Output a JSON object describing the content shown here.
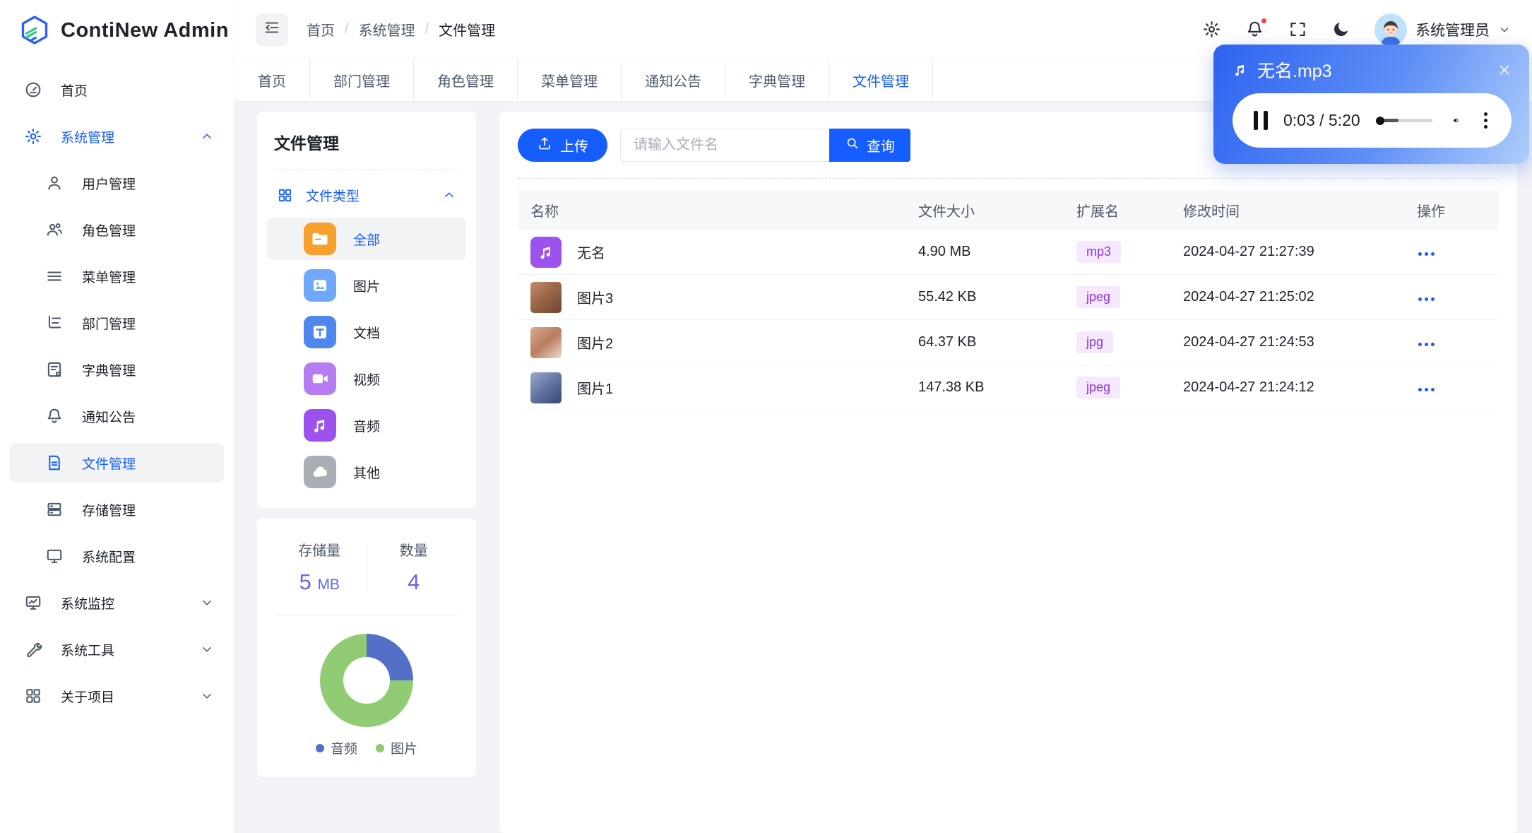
{
  "app": {
    "title": "ContiNew Admin",
    "logo_icon": "logo-hexagon"
  },
  "header": {
    "collapse_icon": "sidebar-collapse",
    "breadcrumb": {
      "items": [
        "首页",
        "系统管理",
        "文件管理"
      ],
      "separator": "/"
    },
    "action_icons": [
      "gear",
      "bell",
      "fullscreen",
      "moon"
    ],
    "bell_has_red_dot": true,
    "user": {
      "name": "系统管理员",
      "dropdown_icon": "chevron-down"
    }
  },
  "sidebar": {
    "items": [
      {
        "label": "首页",
        "icon": "dashboard"
      },
      {
        "label": "系统管理",
        "icon": "gear",
        "expanded": true
      },
      {
        "label": "用户管理",
        "icon": "user"
      },
      {
        "label": "角色管理",
        "icon": "users"
      },
      {
        "label": "菜单管理",
        "icon": "menu"
      },
      {
        "label": "部门管理",
        "icon": "tree"
      },
      {
        "label": "字典管理",
        "icon": "dict"
      },
      {
        "label": "通知公告",
        "icon": "bell"
      },
      {
        "label": "文件管理",
        "icon": "file",
        "active": true
      },
      {
        "label": "存储管理",
        "icon": "storage"
      },
      {
        "label": "系统配置",
        "icon": "config"
      },
      {
        "label": "系统监控",
        "icon": "monitor"
      },
      {
        "label": "系统工具",
        "icon": "wrench"
      },
      {
        "label": "关于项目",
        "icon": "grid"
      }
    ]
  },
  "tabs": [
    "首页",
    "部门管理",
    "角色管理",
    "菜单管理",
    "通知公告",
    "字典管理",
    "文件管理"
  ],
  "active_tab": "文件管理",
  "filepanel": {
    "title": "文件管理",
    "tree_header": {
      "label": "文件类型",
      "icon": "grid",
      "chevron": "chevron-up"
    },
    "types": [
      {
        "label": "全部",
        "icon": "folder",
        "color": "#f7a02d",
        "active": true
      },
      {
        "label": "图片",
        "icon": "image",
        "color": "#6fa8f8"
      },
      {
        "label": "文档",
        "icon": "doc",
        "color": "#4f87ef"
      },
      {
        "label": "视频",
        "icon": "video",
        "color": "#b67df2"
      },
      {
        "label": "音频",
        "icon": "music",
        "color": "#9c52ec"
      },
      {
        "label": "其他",
        "icon": "cloud",
        "color": "#a9adb5"
      }
    ]
  },
  "stats": {
    "storage_label": "存储量",
    "storage_value": "5",
    "storage_unit": "MB",
    "count_label": "数量",
    "count_value": "4"
  },
  "chart_data": {
    "type": "pie",
    "donut": true,
    "labels": [
      "音频",
      "图片"
    ],
    "values": [
      25,
      75
    ],
    "unit": "percent_of_files",
    "colors": [
      "#5470c6",
      "#91cc75"
    ],
    "legend_position": "bottom"
  },
  "toolbar": {
    "upload_label": "上传",
    "upload_icon": "upload",
    "search_placeholder": "请输入文件名",
    "search_value": "",
    "query_label": "查询",
    "query_icon": "search"
  },
  "table": {
    "columns": [
      "名称",
      "文件大小",
      "扩展名",
      "修改时间",
      "操作"
    ],
    "rows": [
      {
        "name": "无名",
        "kind": "audio",
        "size": "4.90 MB",
        "ext": "mp3",
        "time": "2024-04-27 21:27:39"
      },
      {
        "name": "图片3",
        "kind": "image",
        "size": "55.42 KB",
        "ext": "jpeg",
        "time": "2024-04-27 21:25:02"
      },
      {
        "name": "图片2",
        "kind": "image",
        "size": "64.37 KB",
        "ext": "jpg",
        "time": "2024-04-27 21:24:53"
      },
      {
        "name": "图片1",
        "kind": "image",
        "size": "147.38 KB",
        "ext": "jpeg",
        "time": "2024-04-27 21:24:12"
      }
    ],
    "row_action_icon": "more-horizontal"
  },
  "player": {
    "icon": "music-note",
    "title": "无名.mp3",
    "close_icon": "close",
    "state_icon": "pause",
    "time": "0:03 / 5:20",
    "progress_percent": 40,
    "thumb_percent": 8,
    "volume_icon": "volume",
    "menu_icon": "kebab-vertical",
    "gradient": [
      "#2e63f1",
      "#aecdfb"
    ]
  },
  "colors": {
    "primary": "#165DFF",
    "stat_number": "#6266f1",
    "ext_badge_bg": "#f5e8ff",
    "ext_badge_text": "#8a38d8"
  }
}
